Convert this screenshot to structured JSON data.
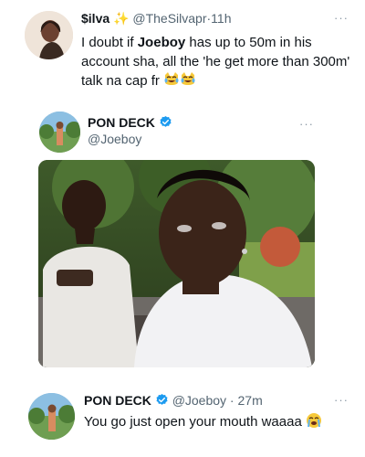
{
  "tweet1": {
    "name": "$ilva",
    "name_decoration": "✨",
    "handle": "@TheSilvapr",
    "time": "11h",
    "text_before": "I doubt if ",
    "text_bold": "Joeboy",
    "text_after": " has up to 50m in his account sha, all the 'he get more than 300m' talk na cap fr",
    "emojis": [
      "crying-laughing-cat-emoji",
      "crying-laughing-cat-emoji"
    ],
    "more": "···"
  },
  "quoted": {
    "name": "PON DECK",
    "handle": "@Joeboy",
    "more": "···"
  },
  "tweet2": {
    "name": "PON DECK",
    "handle": "@Joeboy",
    "time": "27m",
    "text": "You go just open your mouth waaaa",
    "emoji": "loudly-crying-face-emoji",
    "more": "···"
  },
  "colors": {
    "text": "#0f1419",
    "secondary": "#536471",
    "verified": "#1d9bf0",
    "sparkle": "#f2b400",
    "background": "#ffffff"
  }
}
